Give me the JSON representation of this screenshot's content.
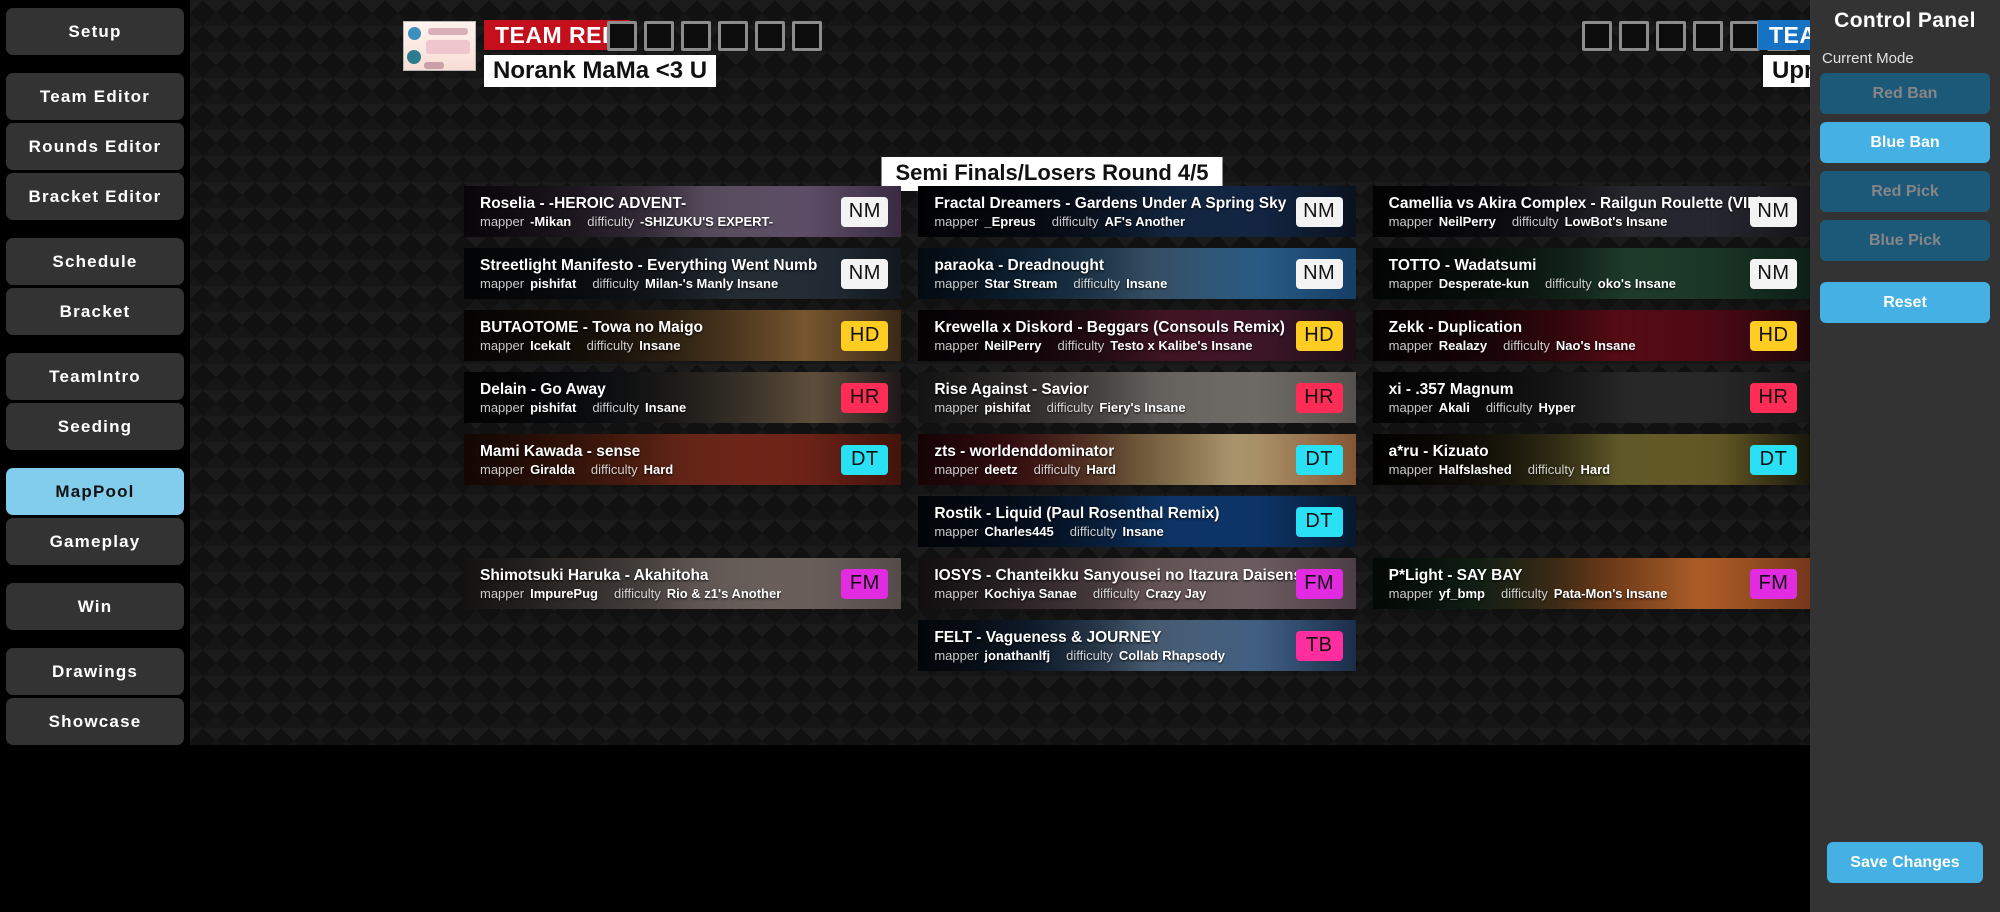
{
  "sidebar": {
    "groups": [
      {
        "items": [
          {
            "label": "Setup",
            "active": false,
            "name": "setup"
          }
        ]
      },
      {
        "items": [
          {
            "label": "Team Editor",
            "active": false,
            "name": "team-editor"
          },
          {
            "label": "Rounds Editor",
            "active": false,
            "name": "rounds-editor"
          },
          {
            "label": "Bracket Editor",
            "active": false,
            "name": "bracket-editor"
          }
        ]
      },
      {
        "items": [
          {
            "label": "Schedule",
            "active": false,
            "name": "schedule"
          },
          {
            "label": "Bracket",
            "active": false,
            "name": "bracket"
          }
        ]
      },
      {
        "items": [
          {
            "label": "TeamIntro",
            "active": false,
            "name": "teamintro"
          },
          {
            "label": "Seeding",
            "active": false,
            "name": "seeding"
          }
        ]
      },
      {
        "items": [
          {
            "label": "MapPool",
            "active": true,
            "name": "mappool"
          },
          {
            "label": "Gameplay",
            "active": false,
            "name": "gameplay"
          }
        ]
      },
      {
        "items": [
          {
            "label": "Win",
            "active": false,
            "name": "win"
          }
        ]
      },
      {
        "items": [
          {
            "label": "Drawings",
            "active": false,
            "name": "drawings"
          },
          {
            "label": "Showcase",
            "active": false,
            "name": "showcase"
          }
        ]
      }
    ]
  },
  "header": {
    "red": {
      "tag": "TEAM RED",
      "name": "Norank MaMa <3 U",
      "tag_color": "#c40f1c",
      "score": 0,
      "score_boxes": 6
    },
    "blue": {
      "tag": "TEAM BLUE",
      "name": "Uprankers",
      "tag_color": "#1572c4",
      "score": 0,
      "score_boxes": 6
    }
  },
  "round": {
    "title": "Semi Finals/Losers Round 4/5"
  },
  "mod_colors": {
    "NM": "#f3f3f3",
    "HD": "#ffcc22",
    "HR": "#ff2d55",
    "DT": "#2ae0f5",
    "FM": "#e22ae0",
    "TB": "#ff2d9e"
  },
  "pool": {
    "columns": [
      {
        "slots": [
          {
            "type": "map",
            "title": "Roselia - -HEROIC ADVENT-",
            "mapper_label": "mapper",
            "mapper": "-Mikan",
            "difficulty_label": "difficulty",
            "difficulty": "-SHIZUKU'S EXPERT-",
            "mod": "NM",
            "bg": "linear-gradient(90deg,#2b2230 0%,#5a4560 28%,#8d7b96 55%,#6d5a78 78%,#3b2d44 100%)"
          },
          {
            "type": "map",
            "title": "Streetlight Manifesto - Everything Went Numb",
            "mapper_label": "mapper",
            "mapper": "pishifat",
            "difficulty_label": "difficulty",
            "difficulty": "Milan-'s Manly Insane",
            "mod": "NM",
            "bg": "linear-gradient(90deg,#101418 0%,#1d2630 35%,#36414c 62%,#232d38 85%,#13181e 100%)"
          },
          {
            "type": "map",
            "title": "BUTAOTOME - Towa no Maigo",
            "mapper_label": "mapper",
            "mapper": "Icekalt",
            "difficulty_label": "difficulty",
            "difficulty": "Insane",
            "mod": "HD",
            "bg": "linear-gradient(90deg,#1d150d 0%,#3b2a18 30%,#6b4d2b 58%,#8a6537 78%,#3c2a17 100%)"
          },
          {
            "type": "map",
            "title": "Delain - Go Away",
            "mapper_label": "mapper",
            "mapper": "pishifat",
            "difficulty_label": "difficulty",
            "difficulty": "Insane",
            "mod": "HR",
            "bg": "linear-gradient(90deg,#0e0e10 0%,#1e2228 32%,#494136 60%,#6d5a45 80%,#20191a 100%)"
          },
          {
            "type": "map",
            "title": "Mami Kawada - sense",
            "mapper_label": "mapper",
            "mapper": "Giralda",
            "difficulty_label": "difficulty",
            "difficulty": "Hard",
            "mod": "DT",
            "bg": "linear-gradient(90deg,#67260f 0%,#97381a 25%,#b8452a 48%,#8e2d1e 72%,#45140c 100%)"
          },
          {
            "type": "empty"
          },
          {
            "type": "map",
            "title": "Shimotsuki Haruka - Akahitoha",
            "mapper_label": "mapper",
            "mapper": "ImpurePug",
            "difficulty_label": "difficulty",
            "difficulty": "Rio & z1's Another",
            "mod": "FM",
            "bg": "linear-gradient(90deg,#6e6a66 0%,#8d8179 28%,#a59690 52%,#7d6f6b 78%,#57504d 100%)"
          }
        ]
      },
      {
        "slots": [
          {
            "type": "map",
            "title": "Fractal Dreamers - Gardens Under A Spring Sky",
            "mapper_label": "mapper",
            "mapper": "_Epreus",
            "difficulty_label": "difficulty",
            "difficulty": "AF's Another",
            "mod": "NM",
            "bg": "linear-gradient(90deg,#070c16 0%,#101e36 30%,#1d3a63 58%,#14294a 80%,#0a121f 100%)"
          },
          {
            "type": "map",
            "title": "paraoka - Dreadnought",
            "mapper_label": "mapper",
            "mapper": "Star Stream",
            "difficulty_label": "difficulty",
            "difficulty": "Insane",
            "mod": "NM",
            "bg": "linear-gradient(90deg,#123a63 0%,#2a6496 26%,#5c87ad 52%,#2e6a9b 78%,#16406b 100%)"
          },
          {
            "type": "map",
            "title": "Krewella x Diskord - Beggars (Consouls Remix)",
            "mapper_label": "mapper",
            "mapper": "NeilPerry",
            "difficulty_label": "difficulty",
            "difficulty": "Testo x Kalibe's Insane",
            "mod": "HD",
            "bg": "linear-gradient(90deg,#190c14 0%,#3a1322 30%,#6a2038 56%,#43182c 80%,#1d0d16 100%)"
          },
          {
            "type": "map",
            "title": "Rise Against - Savior",
            "mapper_label": "mapper",
            "mapper": "pishifat",
            "difficulty_label": "difficulty",
            "difficulty": "Fiery's Insane",
            "mod": "HR",
            "bg": "linear-gradient(90deg,#6d6a68 0%,#8e8a86 28%,#a8a39d 54%,#807b76 78%,#585450 100%)"
          },
          {
            "type": "map",
            "title": "zts - worldenddominator",
            "mapper_label": "mapper",
            "mapper": "deetz",
            "difficulty_label": "difficulty",
            "difficulty": "Hard",
            "mod": "DT",
            "bg": "linear-gradient(90deg,#7a1020 0%,#a52c31 22%,#c8a06a 50%,#d6bd8a 72%,#8a5a34 100%)"
          },
          {
            "type": "map",
            "title": "Rostik - Liquid (Paul Rosenthal Remix)",
            "mapper_label": "mapper",
            "mapper": "Charles445",
            "difficulty_label": "difficulty",
            "difficulty": "Insane",
            "mod": "DT",
            "bg": "linear-gradient(90deg,#061428 0%,#0e2e5c 28%,#1554a3 55%,#0f3c78 78%,#071930 100%)"
          },
          {
            "type": "map",
            "title": "IOSYS - Chanteikku Sanyousei no Itazura Daisensou",
            "mapper_label": "mapper",
            "mapper": "Kochiya Sanae",
            "difficulty_label": "difficulty",
            "difficulty": "Crazy Jay",
            "mod": "FM",
            "bg": "linear-gradient(90deg,#605058 0%,#8a707a 26%,#a98d8f 52%,#7e6a70 78%,#4e4147 100%)"
          },
          {
            "type": "map",
            "title": "FELT - Vagueness & JOURNEY",
            "mapper_label": "mapper",
            "mapper": "jonathanlfj",
            "difficulty_label": "difficulty",
            "difficulty": "Collab Rhapsody",
            "mod": "TB",
            "bg": "linear-gradient(90deg,#0f1c30 0%,#2a4d78 26%,#7a9cc0 52%,#4a6e98 78%,#1b2f4c 100%)"
          }
        ]
      },
      {
        "slots": [
          {
            "type": "map",
            "title": "Camellia vs Akira Complex - Railgun Roulette (VIP)",
            "mapper_label": "mapper",
            "mapper": "NeilPerry",
            "difficulty_label": "difficulty",
            "difficulty": "LowBot's Insane",
            "mod": "NM",
            "bg": "linear-gradient(90deg,#101014 0%,#20202a 32%,#3b3b46 58%,#2a2a34 80%,#141418 100%)"
          },
          {
            "type": "map",
            "title": "TOTTO - Wadatsumi",
            "mapper_label": "mapper",
            "mapper": "Desperate-kun",
            "difficulty_label": "difficulty",
            "difficulty": "oko's Insane",
            "mod": "NM",
            "bg": "linear-gradient(90deg,#0b1a12 0%,#183024 30%,#2f5c42 58%,#1c3b2a 80%,#0d2018 100%)"
          },
          {
            "type": "map",
            "title": "Zekk - Duplication",
            "mapper_label": "mapper",
            "mapper": "Realazy",
            "difficulty_label": "difficulty",
            "difficulty": "Nao's Insane",
            "mod": "HD",
            "bg": "linear-gradient(90deg,#1a0408 0%,#4a0a14 28%,#8c1222 55%,#520a16 80%,#1e050a 100%)"
          },
          {
            "type": "map",
            "title": "xi - .357 Magnum",
            "mapper_label": "mapper",
            "mapper": "Akali",
            "difficulty_label": "difficulty",
            "difficulty": "Hyper",
            "mod": "HR",
            "bg": "linear-gradient(90deg,#121212 0%,#242424 32%,#3e3e3e 58%,#2c2c2c 80%,#161616 100%)"
          },
          {
            "type": "map",
            "title": "a*ru - Kizuato",
            "mapper_label": "mapper",
            "mapper": "Halfslashed",
            "difficulty_label": "difficulty",
            "difficulty": "Hard",
            "mod": "DT",
            "bg": "linear-gradient(90deg,#0d0b06 0%,#3b3318 28%,#9c8f40 56%,#6d6128 80%,#1a170c 100%)"
          },
          {
            "type": "empty"
          },
          {
            "type": "map",
            "title": "P*Light - SAY BAY",
            "mapper_label": "mapper",
            "mapper": "yf_bmp",
            "difficulty_label": "difficulty",
            "difficulty": "Pata-Mon's Insane",
            "mod": "FM",
            "bg": "linear-gradient(90deg,#12301f 0%,#2c5a3a 22%,#b4602a 52%,#d2722f 74%,#7a3a1c 100%)"
          }
        ]
      }
    ]
  },
  "panel": {
    "title": "Control Panel",
    "current_mode_label": "Current Mode",
    "modes": [
      {
        "label": "Red Ban",
        "active": false
      },
      {
        "label": "Blue Ban",
        "active": true
      },
      {
        "label": "Red Pick",
        "active": false
      },
      {
        "label": "Blue Pick",
        "active": false
      }
    ],
    "reset_label": "Reset",
    "save_label": "Save Changes",
    "accent": "#44b0e3",
    "inactive": "#1c5878"
  }
}
